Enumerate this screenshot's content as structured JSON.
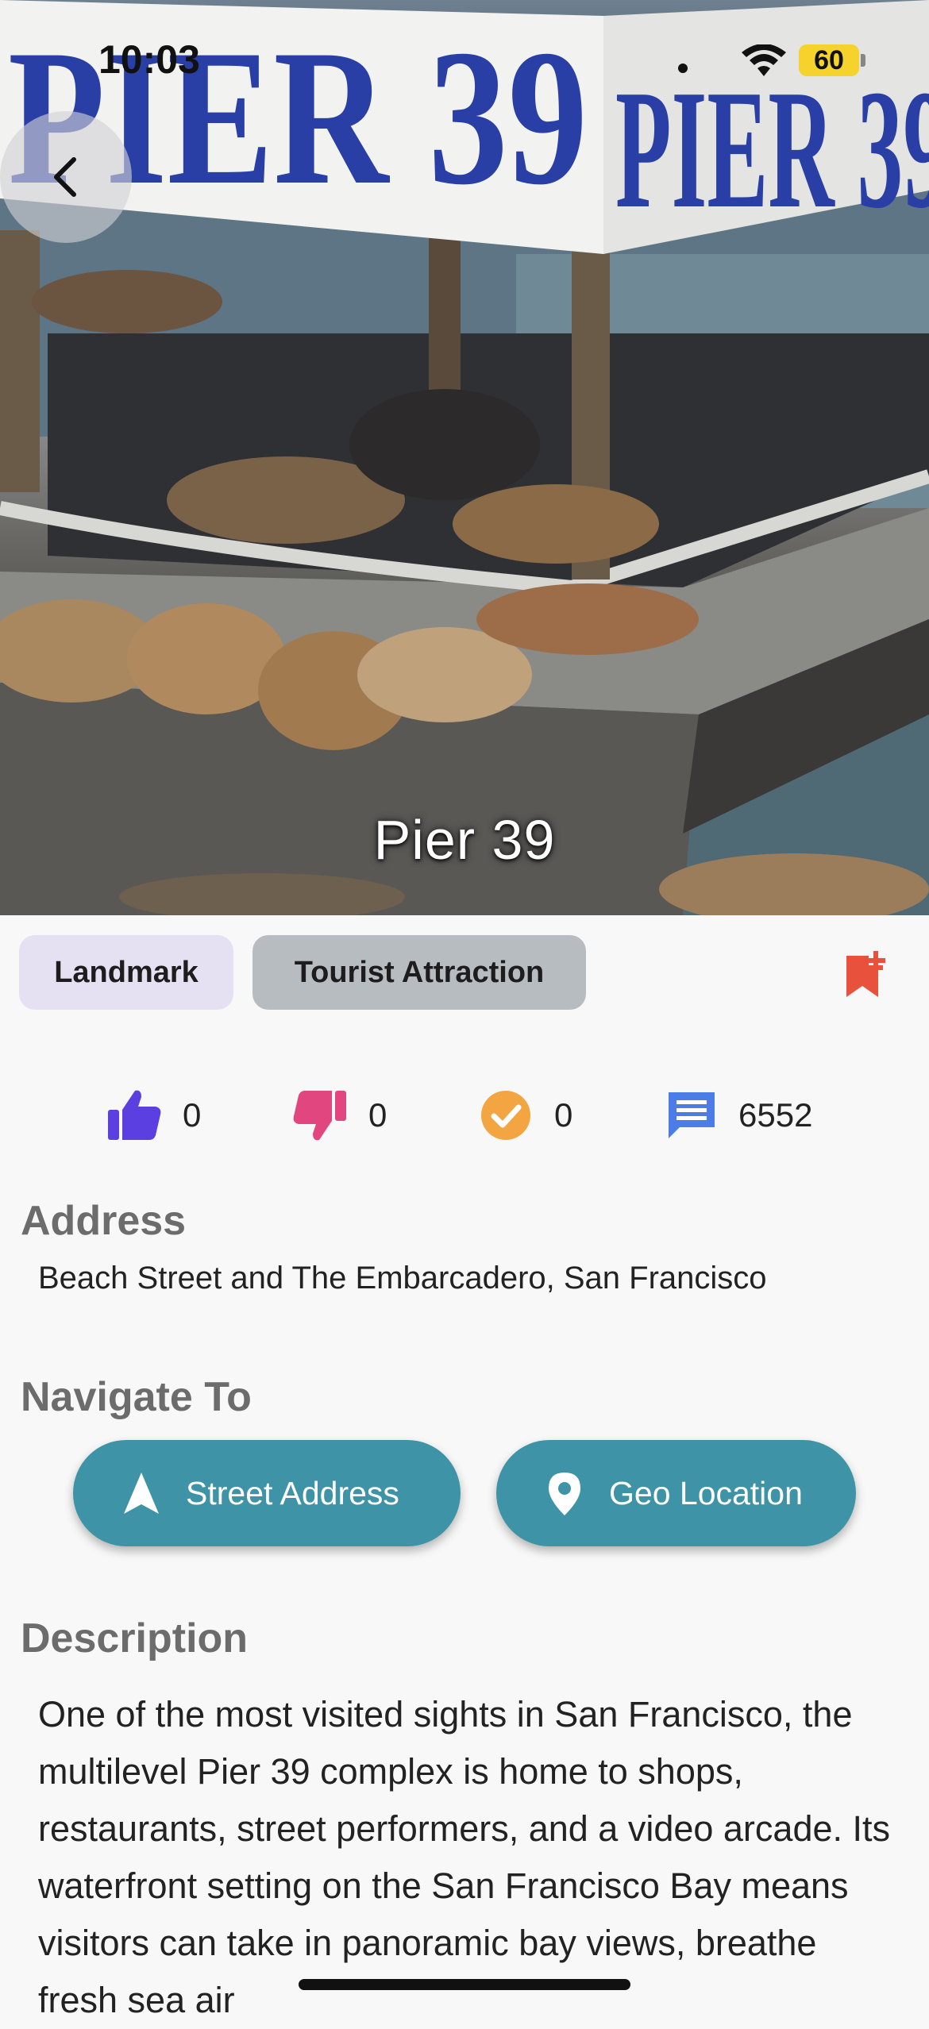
{
  "status_bar": {
    "time": "10:03",
    "battery": "60"
  },
  "hero": {
    "sign_text": "PIER 39",
    "title": "Pier 39"
  },
  "tags": [
    "Landmark",
    "Tourist Attraction"
  ],
  "stats": {
    "likes": "0",
    "dislikes": "0",
    "visited": "0",
    "comments": "6552"
  },
  "address": {
    "heading": "Address",
    "text": "Beach Street and The Embarcadero, San Francisco"
  },
  "navigate": {
    "heading": "Navigate To",
    "street_label": "Street Address",
    "geo_label": "Geo Location"
  },
  "description": {
    "heading": "Description",
    "text": "One of the most visited sights in San Francisco, the multilevel Pier 39 complex is home to shops, restaurants, street performers, and a video arcade. Its waterfront setting on the San Francisco Bay means visitors can take in panoramic bay views, breathe fresh sea air"
  },
  "colors": {
    "like": "#5b3fe0",
    "dislike": "#e2467e",
    "visited": "#f2a541",
    "comments": "#4a7de6",
    "bookmark": "#e8513c",
    "nav_button": "#3f93a6"
  },
  "icons": {
    "back": "chevron-left-icon",
    "bookmark": "bookmark-add-icon",
    "like": "thumbs-up-icon",
    "dislike": "thumbs-down-icon",
    "visited": "check-circle-icon",
    "comments": "comment-icon",
    "street": "navigation-arrow-icon",
    "geo": "map-pin-icon"
  }
}
